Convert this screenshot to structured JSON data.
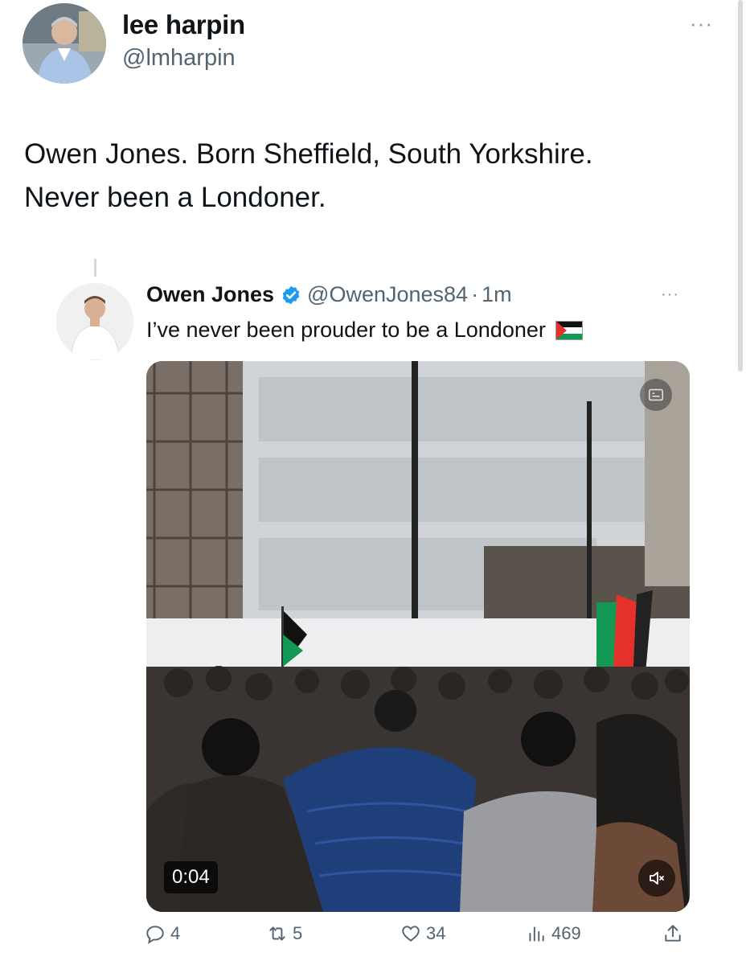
{
  "tweet": {
    "author_name": "lee harpin",
    "author_handle": "@lmharpin",
    "more_label": "···",
    "text_line1": "Owen Jones. Born Sheffield, South Yorkshire.",
    "text_line2": "Never been a Londoner."
  },
  "quoted": {
    "author_name": "Owen Jones",
    "author_handle": "@OwenJones84",
    "separator": "·",
    "time": "1m",
    "more_label": "···",
    "text": "I’ve never been prouder to be a Londoner",
    "flag_icon": "palestine-flag-icon",
    "media": {
      "duration": "0:04",
      "gif_icon": "gif-badge-icon",
      "mute_icon": "volume-muted-icon"
    },
    "actions": {
      "replies": "4",
      "reposts": "5",
      "likes": "34",
      "views": "469"
    }
  },
  "colors": {
    "text": "#0f1419",
    "secondary": "#536471",
    "verified": "#1d9bf0",
    "border": "#cfd9de"
  }
}
